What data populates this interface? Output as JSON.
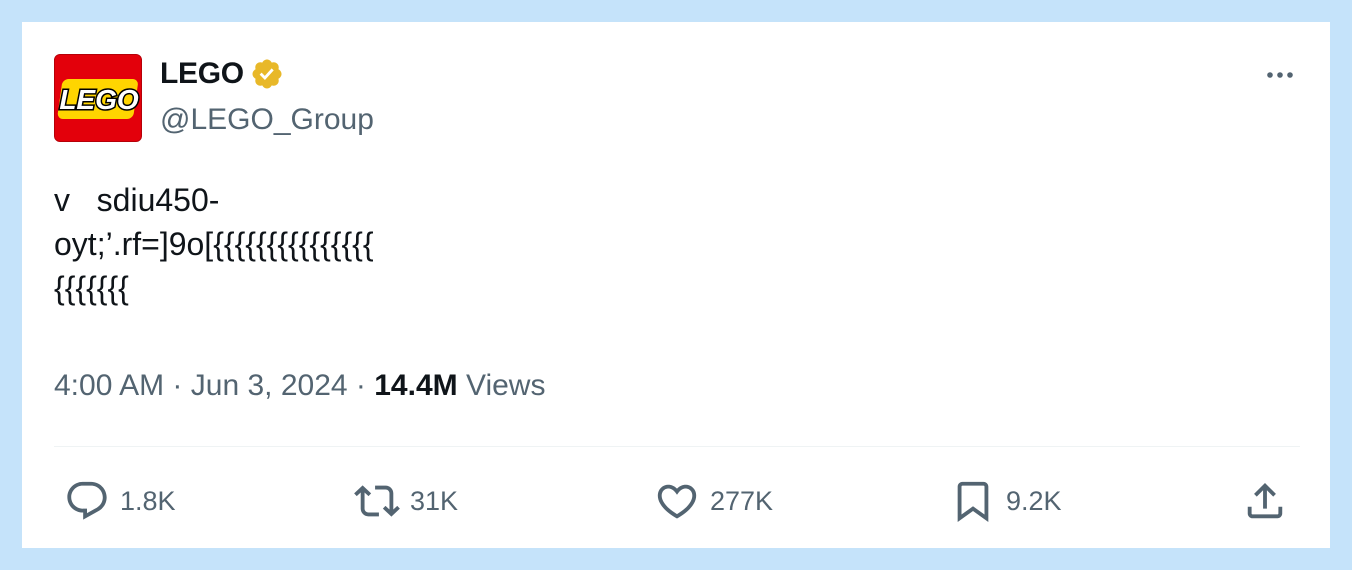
{
  "author": {
    "name": "LEGO",
    "handle": "@LEGO_Group",
    "logo_text": "LEGO",
    "verified": true,
    "verified_color": "#e8b829"
  },
  "tweet": {
    "text": "v   sdiu450-\noyt;’.rf=]9o[{{{{{{{{{{{{{{{\n{{{{{{{",
    "time": "4:00 AM",
    "separator": "·",
    "date": "Jun 3, 2024",
    "views_count": "14.4M",
    "views_label": "Views"
  },
  "actions": {
    "replies": "1.8K",
    "reposts": "31K",
    "likes": "277K",
    "bookmarks": "9.2K"
  },
  "icons": {
    "more": "more-icon",
    "reply": "reply-icon",
    "repost": "repost-icon",
    "like": "heart-icon",
    "bookmark": "bookmark-icon",
    "share": "share-icon"
  },
  "colors": {
    "background": "#c5e3fa",
    "card": "#ffffff",
    "text": "#0f1419",
    "secondary": "#536471",
    "logo_red": "#e3000b"
  }
}
